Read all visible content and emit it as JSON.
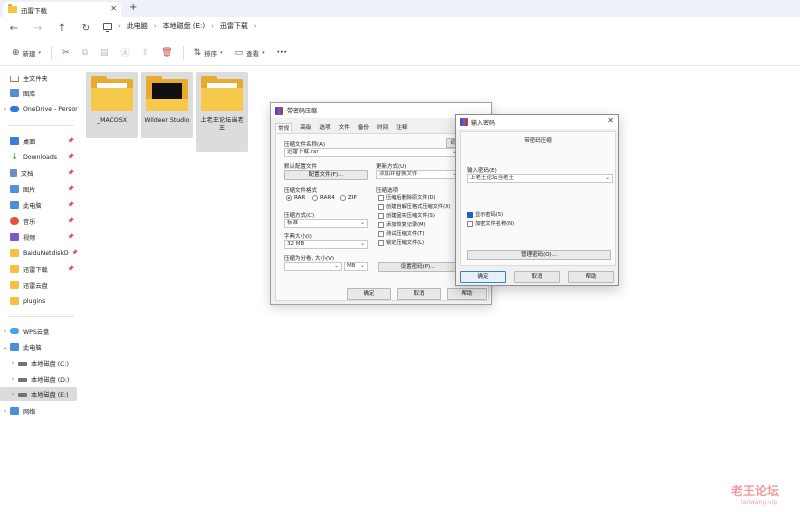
{
  "tabbar": {
    "tab_title": "迅雷下载",
    "close_glyph": "✕",
    "add_glyph": "+"
  },
  "nav": {
    "back": "←",
    "forward": "→",
    "up": "↑",
    "refresh": "↻"
  },
  "breadcrumb": {
    "items": [
      "此电脑",
      "本地磁盘 (E:)",
      "迅雷下载"
    ],
    "separator": "›"
  },
  "toolbar": {
    "new_label": "新建",
    "sort_label": "排序",
    "view_label": "查看",
    "more": "···"
  },
  "sidebar": {
    "items": [
      {
        "label": "主文件夹",
        "icon": "home-icon"
      },
      {
        "label": "图库",
        "icon": "gallery-icon"
      },
      {
        "label": "OneDrive - Persor",
        "icon": "cloud-icon"
      },
      {
        "label": "桌面",
        "icon": "desktop-icon"
      },
      {
        "label": "Downloads",
        "icon": "download-icon"
      },
      {
        "label": "文档",
        "icon": "document-icon"
      },
      {
        "label": "图片",
        "icon": "picture-icon"
      },
      {
        "label": "此电脑",
        "icon": "computer-icon"
      },
      {
        "label": "音乐",
        "icon": "music-icon"
      },
      {
        "label": "视频",
        "icon": "video-icon"
      },
      {
        "label": "BaiduNetdiskD",
        "icon": "folder-icon"
      },
      {
        "label": "迅雷下载",
        "icon": "folder-icon"
      },
      {
        "label": "迅雷云盘",
        "icon": "folder-icon"
      },
      {
        "label": "plugins",
        "icon": "folder-icon"
      },
      {
        "label": "WPS云盘",
        "icon": "cloud-icon"
      },
      {
        "label": "此电脑",
        "icon": "computer-icon"
      },
      {
        "label": "本地磁盘 (C:)",
        "icon": "drive-icon"
      },
      {
        "label": "本地磁盘 (D:)",
        "icon": "drive-icon"
      },
      {
        "label": "本地磁盘 (E:)",
        "icon": "drive-icon"
      },
      {
        "label": "网络",
        "icon": "network-icon"
      }
    ]
  },
  "files": [
    {
      "name": "_MACOSX"
    },
    {
      "name": "Wildeer Studio"
    },
    {
      "name": "上老王论坛当老王"
    }
  ],
  "archive_dialog": {
    "title": "带密码压缩",
    "help_short": "词",
    "tabs": [
      "常规",
      "高级",
      "选项",
      "文件",
      "备份",
      "时间",
      "注释"
    ],
    "archive_name_label": "压缩文件名称(A)",
    "archive_name_value": "迅雷下载.rar",
    "profile_label": "默认配置文件",
    "profile_button": "配置文件(F)...",
    "update_label": "更新方式(U)",
    "update_value": "添加并替换文件",
    "format_label": "压缩文件格式",
    "formats": [
      "RAR",
      "RAR4",
      "ZIP"
    ],
    "method_label": "压缩方式(C)",
    "method_value": "标准",
    "dict_label": "字典大小(I)",
    "dict_value": "32 MB",
    "split_label": "压缩为分卷, 大小(V)",
    "split_unit": "MB",
    "options_label": "压缩选项",
    "options": [
      "压缩后删除原文件(D)",
      "创建自解压格式压缩文件(X)",
      "创建固实压缩文件(S)",
      "添加恢复记录(M)",
      "测试压缩文件(T)",
      "锁定压缩文件(L)"
    ],
    "set_password_button": "设置密码(P)...",
    "ok": "确定",
    "cancel": "取消",
    "help": "帮助"
  },
  "password_dialog": {
    "title": "输入密码",
    "header": "带密码压缩",
    "enter_label": "输入密码(E)",
    "password_value": "上老王论坛当老王",
    "show_password": "显示密码(S)",
    "encrypt_names": "加密文件名称(N)",
    "manage_button": "管理密码(O)...",
    "ok": "确定",
    "cancel": "取消",
    "help": "帮助",
    "close": "✕"
  },
  "watermark": {
    "main": "老王论坛",
    "sub": "laowang.vip"
  }
}
